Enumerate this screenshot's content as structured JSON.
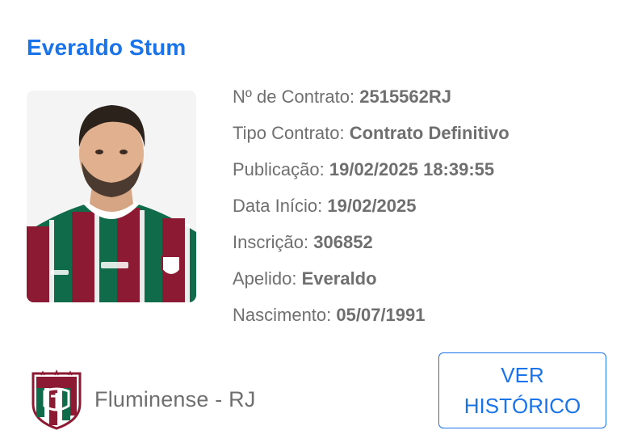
{
  "player": {
    "name": "Everaldo Stum",
    "photo_icon": "player-portrait"
  },
  "details": [
    {
      "label": "Nº de Contrato: ",
      "value": "2515562RJ"
    },
    {
      "label": "Tipo Contrato: ",
      "value": "Contrato Definitivo"
    },
    {
      "label": "Publicação: ",
      "value": "19/02/2025 18:39:55"
    },
    {
      "label": "Data Início: ",
      "value": "19/02/2025"
    },
    {
      "label": "Inscrição: ",
      "value": "306852"
    },
    {
      "label": "Apelido: ",
      "value": "Everaldo"
    },
    {
      "label": "Nascimento: ",
      "value": "05/07/1991"
    }
  ],
  "club": {
    "name": "Fluminense - RJ",
    "crest_icon": "fluminense-crest-icon"
  },
  "history_button": {
    "line1": "VER",
    "line2": "HISTÓRICO"
  },
  "colors": {
    "accent": "#1a73e8",
    "text": "#6f6f6f",
    "club_maroon": "#8c1a33",
    "club_green": "#0f6b4a"
  }
}
